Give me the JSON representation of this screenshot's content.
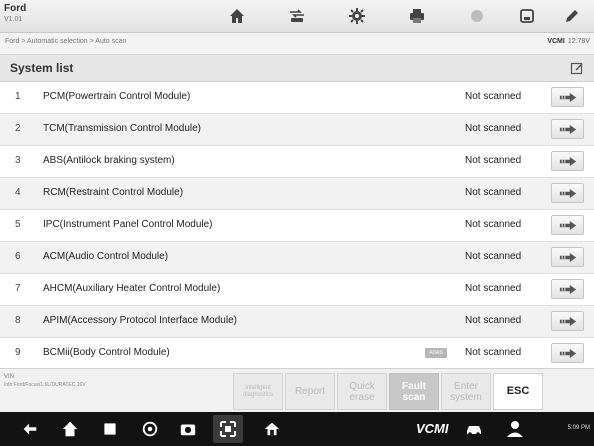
{
  "app": {
    "name": "Ford",
    "version": "V1.01"
  },
  "toolbar": {
    "buttons": [
      {
        "icon": "home-icon"
      },
      {
        "icon": "vehicle-swap-icon"
      },
      {
        "icon": "settings-icon"
      },
      {
        "icon": "print-icon"
      },
      {
        "icon": "help-icon"
      },
      {
        "icon": "save-icon"
      },
      {
        "icon": "edit-icon"
      }
    ]
  },
  "breadcrumb": "Ford > Automatic selection > Auto scan",
  "vcmi": {
    "label": "VCMI",
    "voltage": "12.78V"
  },
  "list": {
    "title": "System list",
    "rows": [
      {
        "index": "1",
        "name": "PCM(Powertrain Control Module)",
        "tag": "",
        "status": "Not scanned"
      },
      {
        "index": "2",
        "name": "TCM(Transmission Control Module)",
        "tag": "",
        "status": "Not scanned"
      },
      {
        "index": "3",
        "name": "ABS(Antilock braking system)",
        "tag": "",
        "status": "Not scanned"
      },
      {
        "index": "4",
        "name": "RCM(Restraint Control Module)",
        "tag": "",
        "status": "Not scanned"
      },
      {
        "index": "5",
        "name": "IPC(Instrument Panel Control Module)",
        "tag": "",
        "status": "Not scanned"
      },
      {
        "index": "6",
        "name": "ACM(Audio Control Module)",
        "tag": "",
        "status": "Not scanned"
      },
      {
        "index": "7",
        "name": "AHCM(Auxiliary Heater Control Module)",
        "tag": "",
        "status": "Not scanned"
      },
      {
        "index": "8",
        "name": "APIM(Accessory Protocol Interface Module)",
        "tag": "",
        "status": "Not scanned"
      },
      {
        "index": "9",
        "name": "BCMii(Body Control Module)",
        "tag": "ADAS",
        "status": "Not scanned"
      }
    ]
  },
  "footer": {
    "vin_label": "VIN",
    "vehicle_info": "Info:Ford/Focus/1.6L/DURATEC,16V",
    "buttons": {
      "intelligent": "Intelligent diagnostics",
      "report": "Report",
      "quick_erase": "Quick erase",
      "fault_scan": "Fault scan",
      "enter_system": "Enter system",
      "esc": "ESC"
    }
  },
  "navbar": {
    "vcmi_label": "VCMI",
    "status": "5:09 PM"
  }
}
